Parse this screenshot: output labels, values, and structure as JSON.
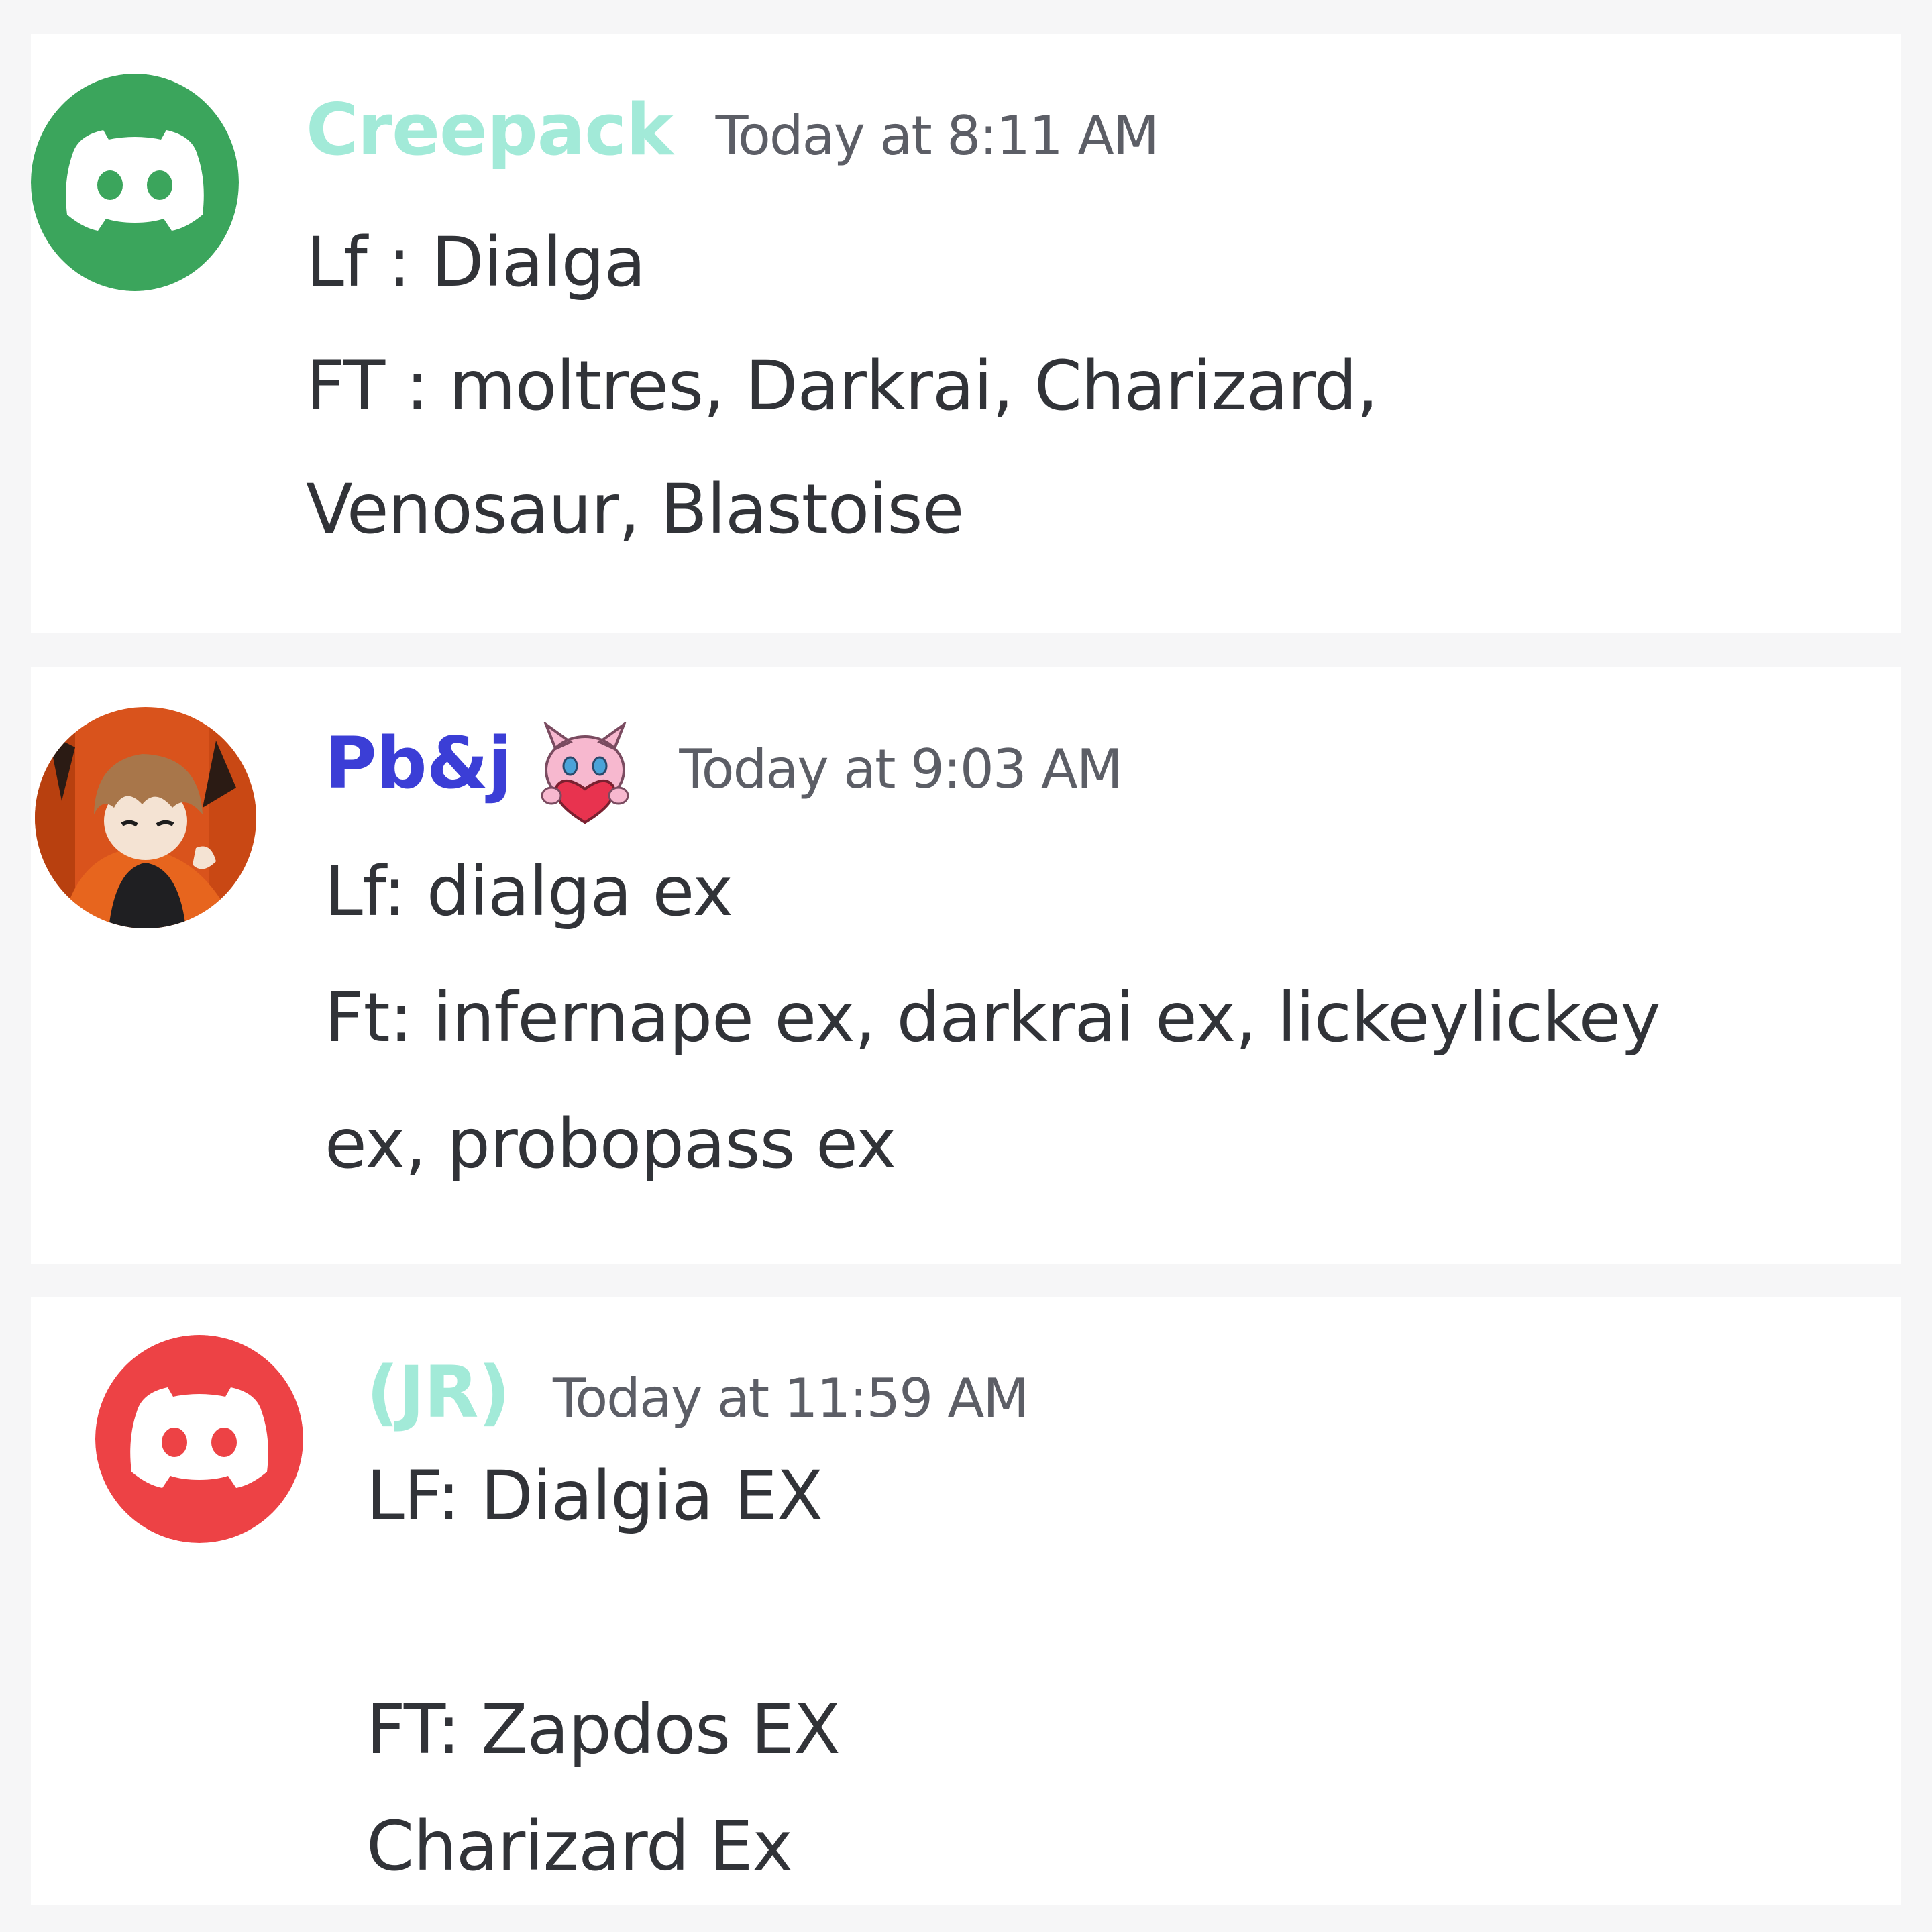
{
  "colors": {
    "page_background": "#f6f6f7",
    "card_background": "#ffffff",
    "message_text": "#313338",
    "timestamp_text": "#5c5e66",
    "discord_green": "#3ba55c",
    "discord_red": "#ed4245",
    "teal_name": "#a2ead8",
    "blue_name": "#3b3ed6"
  },
  "messages": [
    {
      "author": "Creepack",
      "timestamp": "Today at 8:11 AM",
      "avatar_icon": "discord-logo-icon",
      "lines": [
        "Lf : Dialga",
        "FT : moltres, Darkrai, Charizard,",
        "Venosaur, Blastoise"
      ]
    },
    {
      "author": "Pb&j",
      "timestamp": "Today at 9:03 AM",
      "avatar_icon": "anime-avatar-icon",
      "role_icon": "mew-heart-icon",
      "lines": [
        "Lf: dialga ex",
        "Ft: infernape ex, darkrai ex, lickeylickey",
        "ex, probopass ex"
      ]
    },
    {
      "author": "(JR)",
      "timestamp": "Today at 11:59 AM",
      "avatar_icon": "discord-logo-icon",
      "lines": [
        "LF: Dialgia EX",
        "",
        "FT: Zapdos EX",
        "Charizard Ex"
      ]
    }
  ]
}
